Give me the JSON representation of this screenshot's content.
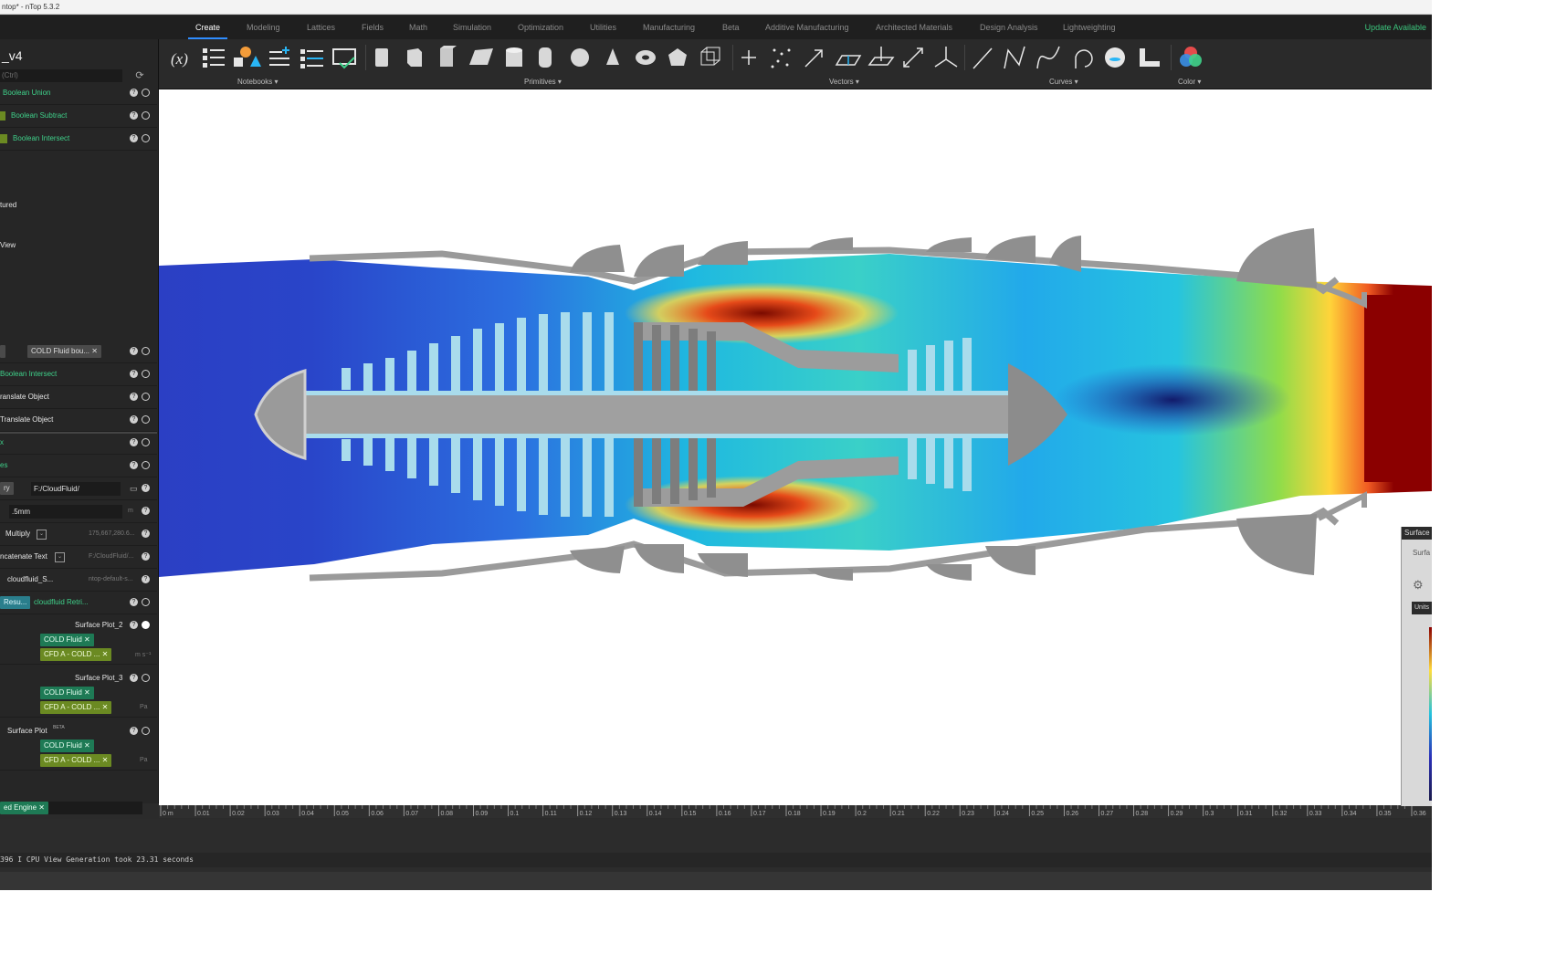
{
  "window": {
    "title": "ntop* - nTop 5.3.2"
  },
  "menu": {
    "tabs": [
      "Create",
      "Modeling",
      "Lattices",
      "Fields",
      "Math",
      "Simulation",
      "Optimization",
      "Utilities",
      "Manufacturing",
      "Beta",
      "Additive Manufacturing",
      "Architected Materials",
      "Design Analysis",
      "Lightweighting"
    ],
    "active_tab": "Create",
    "update_label": "Update Available"
  },
  "toolbar": {
    "groups": [
      {
        "label": "Notebooks"
      },
      {
        "label": "Primitives"
      },
      {
        "label": "Vectors"
      },
      {
        "label": "Curves"
      },
      {
        "label": "Color"
      }
    ],
    "icons": [
      "variable-icon",
      "list-icon",
      "shapes-icon",
      "add-list-icon",
      "numbered-list-icon",
      "checklist-icon",
      "box-primitive-icon",
      "cube-primitive-icon",
      "prism-primitive-icon",
      "plane-primitive-icon",
      "cylinder-primitive-icon",
      "capsule-primitive-icon",
      "sphere-primitive-icon",
      "cone-primitive-icon",
      "torus-primitive-icon",
      "polygon-primitive-icon",
      "wire-cube-icon",
      "point-icon",
      "point-cloud-icon",
      "vector-icon",
      "plane-icon",
      "frame-icon",
      "distance-icon",
      "axes-icon",
      "line-icon",
      "polyline-icon",
      "spline-icon",
      "arc-icon",
      "circle-icon",
      "profile-icon",
      "color-icon"
    ],
    "variable_label": "(x)"
  },
  "left_panel": {
    "title": "_v4",
    "search_placeholder": "(Ctrl)",
    "rows": [
      {
        "label": "Boolean Union"
      },
      {
        "label": "Boolean Subtract"
      },
      {
        "label": "Boolean Intersect"
      },
      {
        "label": "tured"
      },
      {
        "label": "View"
      },
      {
        "label": "COLD Fluid bou..."
      },
      {
        "label": "Boolean Intersect"
      },
      {
        "label": "ranslate Object"
      },
      {
        "label": "Translate Object"
      },
      {
        "label": "ry",
        "value": "F:/CloudFluid/"
      },
      {
        "label": ".5mm",
        "unit": "m"
      },
      {
        "label": "Multiply",
        "value": "175,667,280.6..."
      },
      {
        "label": "ncatenate Text",
        "value": "F:/CloudFluid/..."
      },
      {
        "label": "cloudfluid_S...",
        "value": "ntop-default-s..."
      },
      {
        "label": "Resu...",
        "value": "cloudfluid Retri..."
      },
      {
        "label": "Surface Plot_2"
      },
      {
        "label": "COLD Fluid"
      },
      {
        "label": "CFD A - COLD ...",
        "unit": "m s⁻¹"
      },
      {
        "label": "Surface Plot_3"
      },
      {
        "label": "COLD Fluid"
      },
      {
        "label": "CFD A - COLD ...",
        "unit": "Pa"
      },
      {
        "label": "Surface Plot",
        "badge": "BETA"
      },
      {
        "label": "COLD Fluid"
      },
      {
        "label": "CFD A - COLD ...",
        "unit": "Pa"
      }
    ],
    "engine_tab": "ed Engine"
  },
  "ruler": {
    "ticks": [
      "0 m",
      "0.01",
      "0.02",
      "0.03",
      "0.04",
      "0.05",
      "0.06",
      "0.07",
      "0.08",
      "0.09",
      "0.1",
      "0.11",
      "0.12",
      "0.13",
      "0.14",
      "0.15",
      "0.16",
      "0.17",
      "0.18",
      "0.19",
      "0.2",
      "0.21",
      "0.22",
      "0.23",
      "0.24",
      "0.25",
      "0.26",
      "0.27",
      "0.28",
      "0.29",
      "0.3",
      "0.31",
      "0.32",
      "0.33",
      "0.34",
      "0.35",
      "0.36"
    ]
  },
  "legend": {
    "title": "Surface",
    "subtitle": "Surfa",
    "units": "Units"
  },
  "console": {
    "line": "396    I    CPU View Generation took 23.31 seconds"
  },
  "colors": {
    "accent": "#2f8dff",
    "green": "#3fd18a",
    "panel": "#262626"
  }
}
